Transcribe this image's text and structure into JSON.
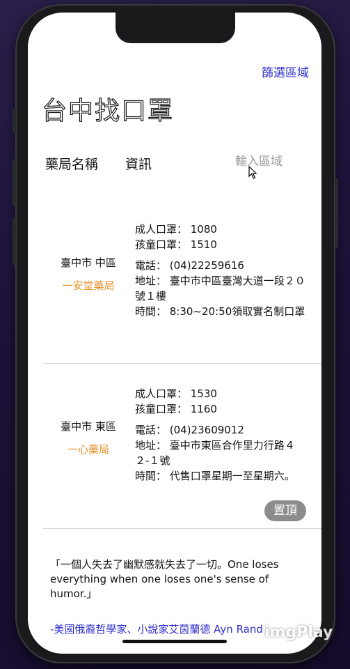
{
  "header": {
    "filter_link": "篩選區域",
    "title": "台中找口罩",
    "col_pharmacy": "藥局名稱",
    "col_info": "資訊",
    "search_placeholder": "輸入區域"
  },
  "pharmacies": [
    {
      "district": "臺中市 中區",
      "name": "一安堂藥局",
      "adult": "成人口罩：  1080",
      "child": "孩童口罩：  1510",
      "phone": "電話：  (04)22259616",
      "address": "地址：  臺中市中區臺灣大道一段２０號１樓",
      "hours": "時間：  8:30~20:50領取實名制口罩"
    },
    {
      "district": "臺中市 東區",
      "name": "一心藥局",
      "adult": "成人口罩：  1530",
      "child": "孩童口罩：  1160",
      "phone": "電話：  (04)23609012",
      "address": "地址：  臺中市東區合作里力行路４２-１號",
      "hours": "時間：  代售口罩星期一至星期六。"
    }
  ],
  "back_to_top": "置頂",
  "footer": {
    "quote": "「一個人失去了幽默感就失去了一切。One loses everything when one loses one's sense of humor.」",
    "author": "-美國俄裔哲學家、小說家艾茵蘭德 Ayn Rand"
  },
  "watermark": "imgPlay",
  "colors": {
    "link": "#2f2fcc",
    "store_name": "#e8932c",
    "top_button": "#8c8c8c"
  }
}
